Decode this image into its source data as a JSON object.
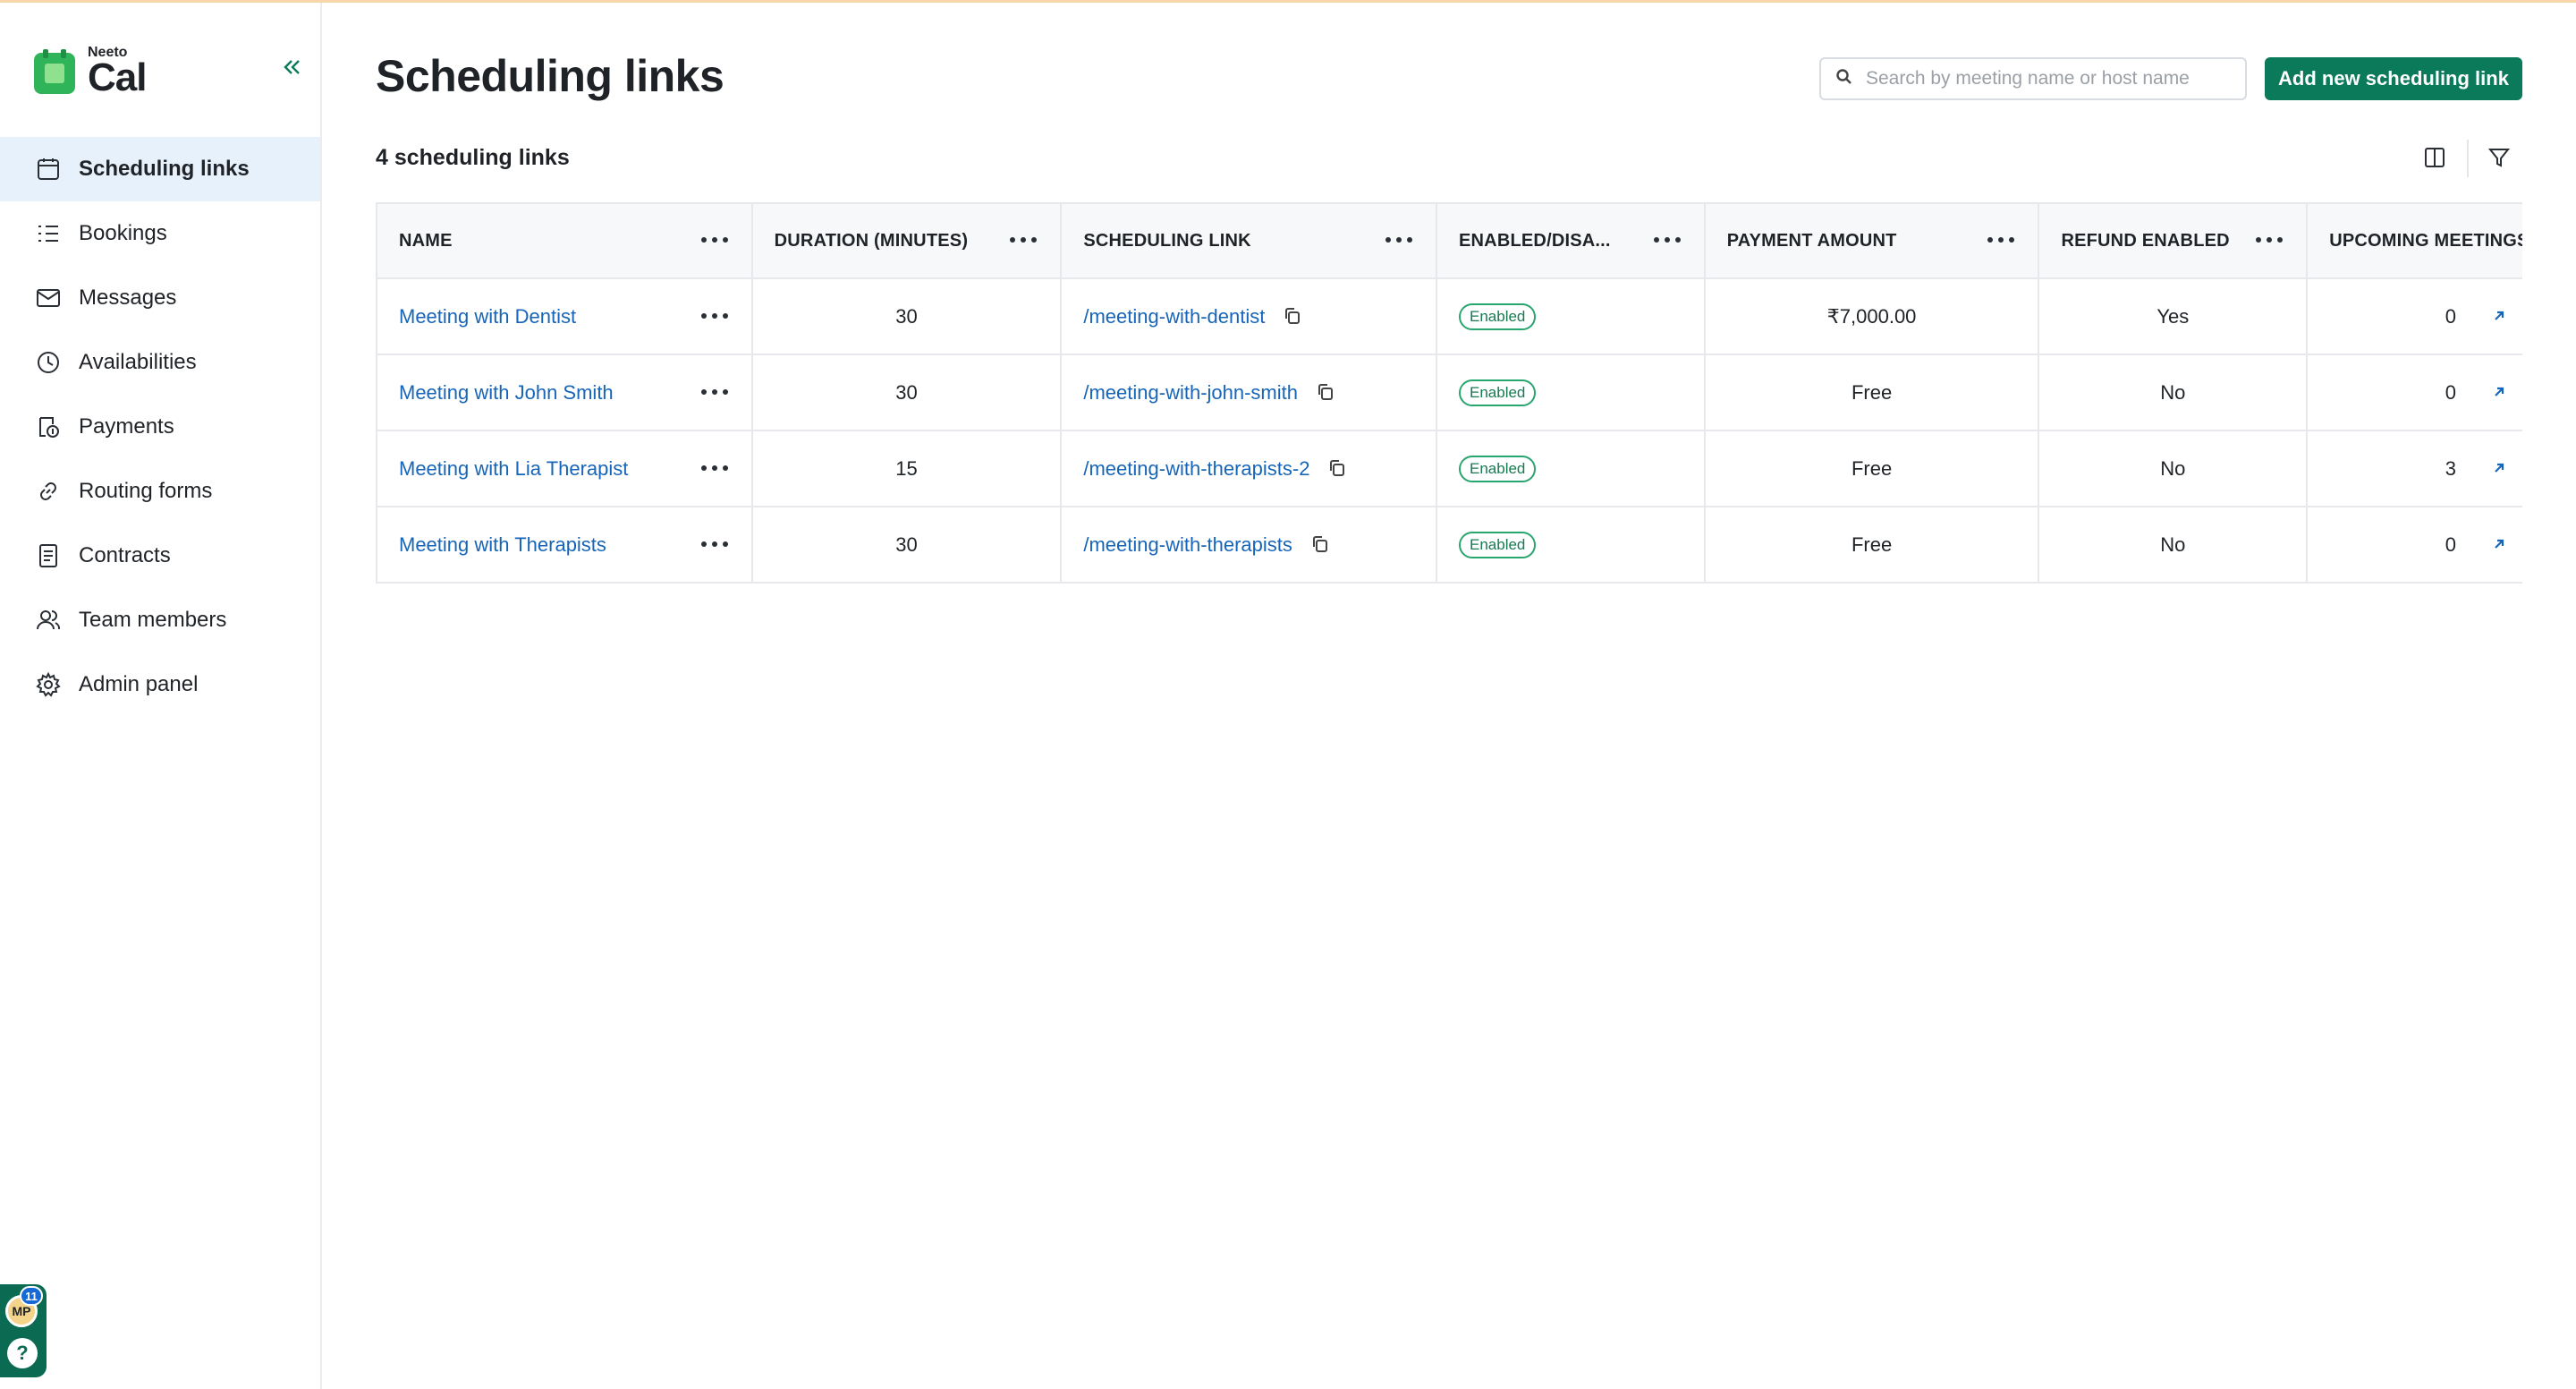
{
  "brand": {
    "small": "Neeto",
    "big": "Cal"
  },
  "sidebar": {
    "items": [
      {
        "label": "Scheduling links",
        "icon": "calendar-icon",
        "active": true
      },
      {
        "label": "Bookings",
        "icon": "list-icon"
      },
      {
        "label": "Messages",
        "icon": "mail-icon"
      },
      {
        "label": "Availabilities",
        "icon": "clock-icon"
      },
      {
        "label": "Payments",
        "icon": "payments-icon"
      },
      {
        "label": "Routing forms",
        "icon": "link-icon"
      },
      {
        "label": "Contracts",
        "icon": "document-icon"
      },
      {
        "label": "Team members",
        "icon": "team-icon"
      },
      {
        "label": "Admin panel",
        "icon": "gear-icon"
      }
    ],
    "avatar_initials": "MP",
    "notification_count": "11",
    "help_glyph": "?"
  },
  "header": {
    "title": "Scheduling links",
    "search_placeholder": "Search by meeting name or host name",
    "add_button": "Add new scheduling link",
    "count_text": "4 scheduling links"
  },
  "table": {
    "columns": [
      "NAME",
      "DURATION (MINUTES)",
      "SCHEDULING LINK",
      "ENABLED/DISA...",
      "PAYMENT AMOUNT",
      "REFUND ENABLED",
      "UPCOMING MEETINGS"
    ],
    "rows": [
      {
        "name": "Meeting with Dentist",
        "duration": "30",
        "link": "/meeting-with-dentist",
        "status": "Enabled",
        "payment": "₹7,000.00",
        "refund": "Yes",
        "upcoming": "0"
      },
      {
        "name": "Meeting with John Smith",
        "duration": "30",
        "link": "/meeting-with-john-smith",
        "status": "Enabled",
        "payment": "Free",
        "refund": "No",
        "upcoming": "0"
      },
      {
        "name": "Meeting with Lia Therapist",
        "duration": "15",
        "link": "/meeting-with-therapists-2",
        "status": "Enabled",
        "payment": "Free",
        "refund": "No",
        "upcoming": "3"
      },
      {
        "name": "Meeting with Therapists",
        "duration": "30",
        "link": "/meeting-with-therapists",
        "status": "Enabled",
        "payment": "Free",
        "refund": "No",
        "upcoming": "0"
      }
    ]
  },
  "colors": {
    "accent": "#0b7a5a",
    "link": "#1765b8",
    "active_bg": "#e6f1fb",
    "badge": "#29a56f"
  }
}
